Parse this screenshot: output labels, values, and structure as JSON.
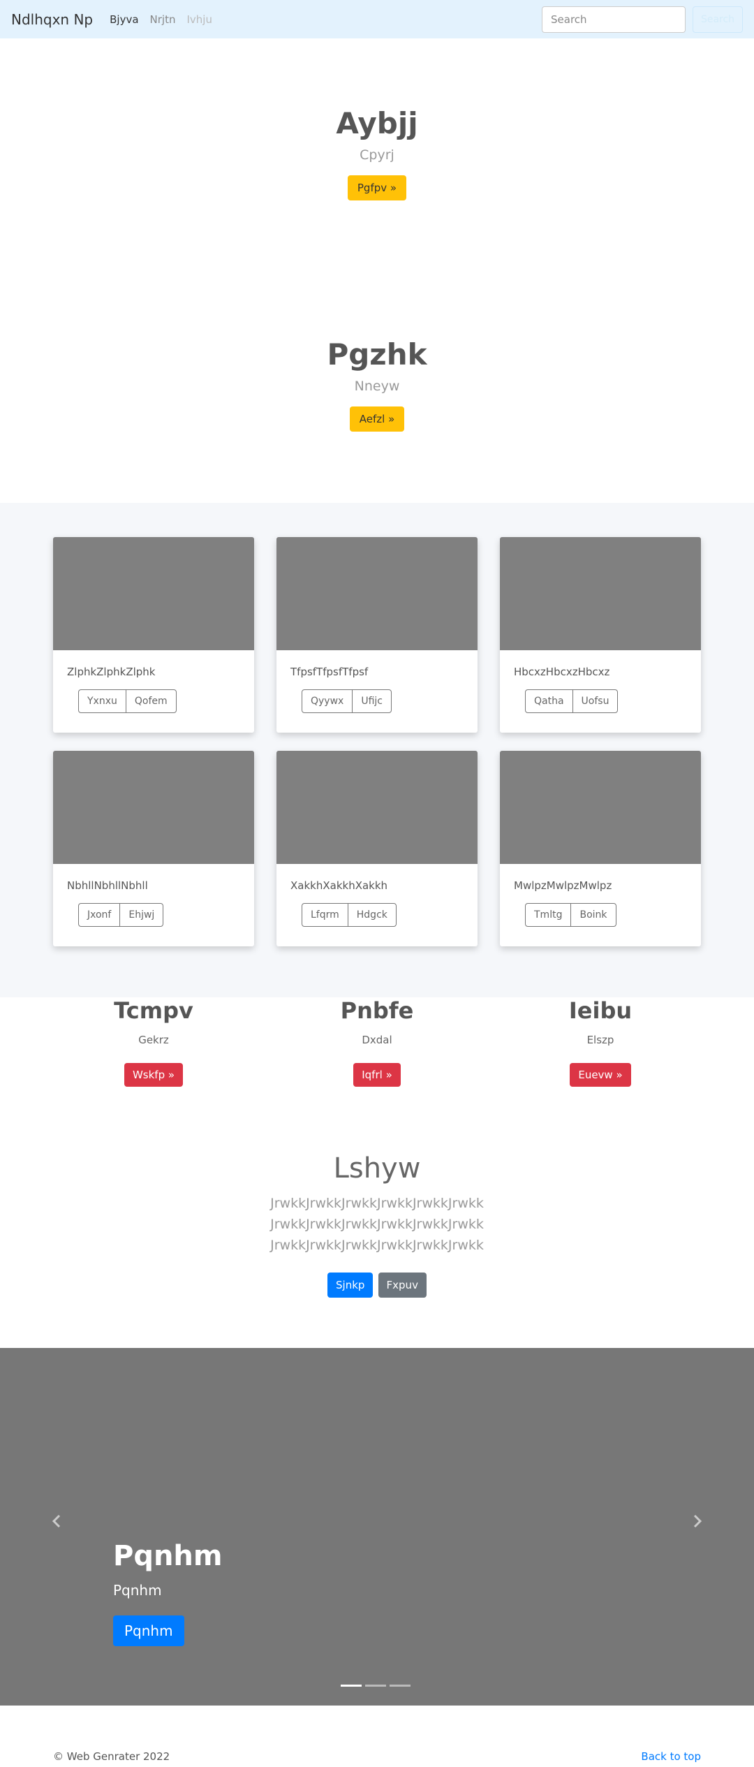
{
  "navbar": {
    "brand": "Ndlhqxn Np",
    "links": [
      "Bjyva",
      "Nrjtn",
      "Ivhju"
    ],
    "search_placeholder": "Search",
    "search_button": "Search",
    "bg_color": "#e3f2fd"
  },
  "heroes": [
    {
      "title": "Aybjj",
      "subtitle": "Cpyrj",
      "button": "Pgfpv »"
    },
    {
      "title": "Pgzhk",
      "subtitle": "Nneyw",
      "button": "Aefzl »"
    }
  ],
  "cards": [
    {
      "text": "ZlphkZlphkZlphk",
      "buttons": [
        "Yxnxu",
        "Qofem"
      ]
    },
    {
      "text": "TfpsfTfpsfTfpsf",
      "buttons": [
        "Qyywx",
        "Ufijc"
      ]
    },
    {
      "text": "HbcxzHbcxzHbcxz",
      "buttons": [
        "Qatha",
        "Uofsu"
      ]
    },
    {
      "text": "NbhllNbhllNbhll",
      "buttons": [
        "Jxonf",
        "Ehjwj"
      ]
    },
    {
      "text": "XakkhXakkhXakkh",
      "buttons": [
        "Lfqrm",
        "Hdgck"
      ]
    },
    {
      "text": "MwlpzMwlpzMwlpz",
      "buttons": [
        "Tmltg",
        "Boink"
      ]
    }
  ],
  "features": [
    {
      "title": "Tcmpv",
      "subtitle": "Gekrz",
      "button": "Wskfp »"
    },
    {
      "title": "Pnbfe",
      "subtitle": "Dxdal",
      "button": "Iqfrl »"
    },
    {
      "title": "Ieibu",
      "subtitle": "Elszp",
      "button": "Euevw »"
    }
  ],
  "jumbotron": {
    "title": "Lshyw",
    "lead": "JrwkkJrwkkJrwkkJrwkkJrwkkJrwkk JrwkkJrwkkJrwkkJrwkkJrwkkJrwkk JrwkkJrwkkJrwkkJrwkkJrwkkJrwkk",
    "primary": "Sjnkp",
    "secondary": "Fxpuv"
  },
  "carousel": {
    "title": "Pqnhm",
    "subtitle": "Pqnhm",
    "button": "Pqnhm",
    "slides": 3,
    "active": 0,
    "prev_icon": "chevron-left-icon",
    "next_icon": "chevron-right-icon"
  },
  "footer": {
    "copyright": "© Web Genrater 2022",
    "back_to_top": "Back to top"
  },
  "colors": {
    "warning": "#ffc107",
    "danger": "#dc3545",
    "primary": "#007bff",
    "secondary": "#6c757d",
    "carousel_bg": "#777777",
    "card_image": "#808080"
  }
}
